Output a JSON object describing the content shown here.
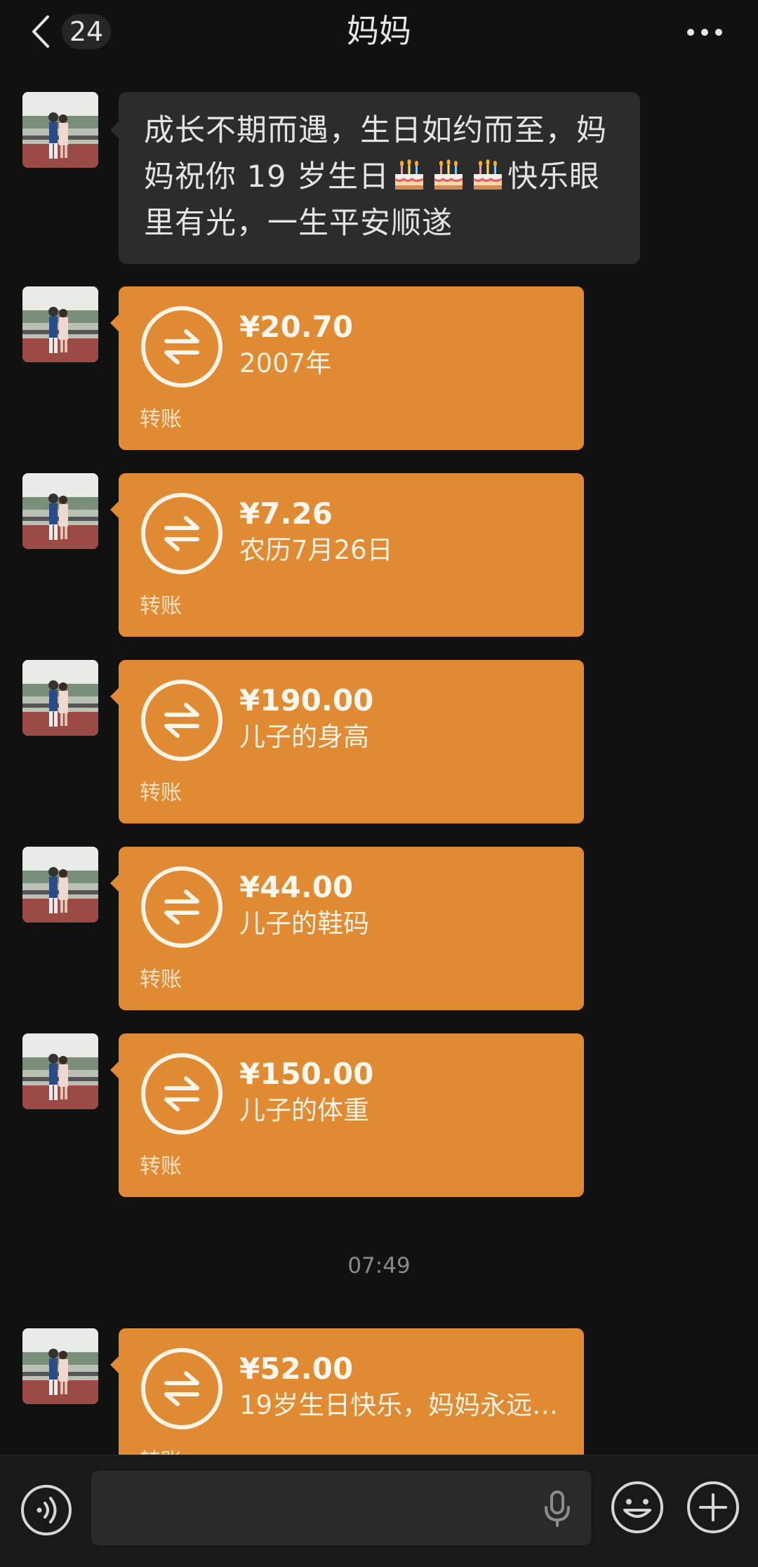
{
  "header": {
    "unread_count": "24",
    "title": "妈妈"
  },
  "messages": {
    "text": {
      "part1": "成长不期而遇，生日如约而至，妈妈祝你 19 岁生日",
      "cake_emojis": [
        "🎂",
        "🎂",
        "🎂"
      ],
      "part2": "快乐眼里有光，一生平安顺遂"
    },
    "transfers": [
      {
        "amount": "¥20.70",
        "note": "2007年",
        "label": "转账"
      },
      {
        "amount": "¥7.26",
        "note": "农历7月26日",
        "label": "转账"
      },
      {
        "amount": "¥190.00",
        "note": "儿子的身高",
        "label": "转账"
      },
      {
        "amount": "¥44.00",
        "note": "儿子的鞋码",
        "label": "转账"
      },
      {
        "amount": "¥150.00",
        "note": "儿子的体重",
        "label": "转账"
      },
      {
        "amount": "¥52.00",
        "note": "19岁生日快乐，妈妈永远…",
        "label": "转账"
      }
    ],
    "timestamp": "07:49"
  },
  "icons": {
    "back": "chevron-left-icon",
    "more": "more-dots-icon",
    "transfer": "transfer-arrows-icon",
    "voice": "voice-icon",
    "mic": "microphone-icon",
    "emoji": "emoji-icon",
    "plus": "plus-icon"
  },
  "colors": {
    "background": "#111111",
    "bubble": "#2c2c2c",
    "transfer": "#e08b33"
  }
}
